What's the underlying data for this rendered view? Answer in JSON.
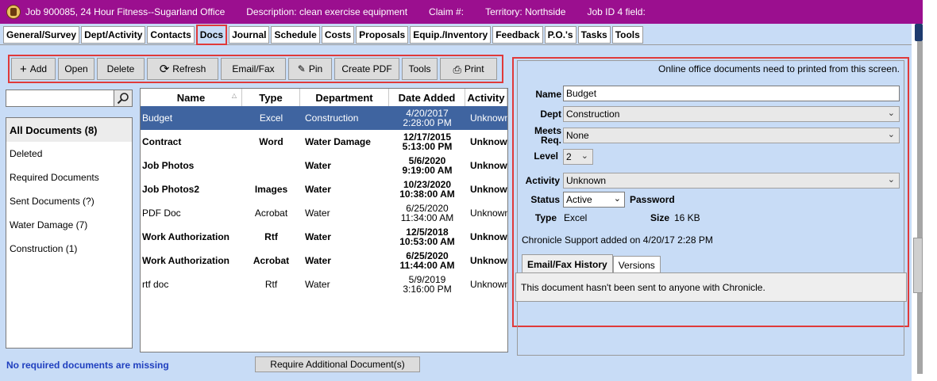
{
  "titlebar": {
    "job": "Job 900085, 24 Hour Fitness--Sugarland Office",
    "description": "Description: clean exercise equipment",
    "claim": "Claim #:",
    "territory": "Territory: Northside",
    "job_id_field": "Job ID 4 field:"
  },
  "tabs": [
    "General/Survey",
    "Dept/Activity",
    "Contacts",
    "Docs",
    "Journal",
    "Schedule",
    "Costs",
    "Proposals",
    "Equip./Inventory",
    "Feedback",
    "P.O.'s",
    "Tasks",
    "Tools"
  ],
  "active_tab": "Docs",
  "toolbar": {
    "add": "Add",
    "open": "Open",
    "delete": "Delete",
    "refresh": "Refresh",
    "email_fax": "Email/Fax",
    "pin": "Pin",
    "create_pdf": "Create PDF",
    "tools": "Tools",
    "print": "Print"
  },
  "search": {
    "value": ""
  },
  "folders": [
    "All Documents (8)",
    "Deleted",
    "Required Documents",
    "Sent Documents (?)",
    "Water Damage (7)",
    "Construction (1)"
  ],
  "table": {
    "headers": {
      "name": "Name",
      "type": "Type",
      "department": "Department",
      "date_added": "Date Added",
      "activity": "Activity"
    },
    "rows": [
      {
        "name": "Budget",
        "type": "Excel",
        "department": "Construction",
        "date": "4/20/2017",
        "time": "2:28:00 PM",
        "activity": "Unknown",
        "bold": false,
        "selected": true
      },
      {
        "name": "Contract",
        "type": "Word",
        "department": "Water Damage",
        "date": "12/17/2015",
        "time": "5:13:00 PM",
        "activity": "Unknown",
        "bold": true,
        "selected": false
      },
      {
        "name": "Job Photos",
        "type": "",
        "department": "Water",
        "date": "5/6/2020",
        "time": "9:19:00 AM",
        "activity": "Unknown",
        "bold": true,
        "selected": false
      },
      {
        "name": "Job Photos2",
        "type": "Images",
        "department": "Water",
        "date": "10/23/2020",
        "time": "10:38:00 AM",
        "activity": "Unknown",
        "bold": true,
        "selected": false
      },
      {
        "name": "PDF Doc",
        "type": "Acrobat",
        "department": "Water",
        "date": "6/25/2020",
        "time": "11:34:00 AM",
        "activity": "Unknown",
        "bold": false,
        "selected": false
      },
      {
        "name": "Work Authorization",
        "type": "Rtf",
        "department": "Water",
        "date": "12/5/2018",
        "time": "10:53:00 AM",
        "activity": "Unknown",
        "bold": true,
        "selected": false
      },
      {
        "name": "Work Authorization",
        "type": "Acrobat",
        "department": "Water",
        "date": "6/25/2020",
        "time": "11:44:00 AM",
        "activity": "Unknown",
        "bold": true,
        "selected": false
      },
      {
        "name": "rtf doc",
        "type": "Rtf",
        "department": "Water",
        "date": "5/9/2019",
        "time": "3:16:00 PM",
        "activity": "Unknown",
        "bold": false,
        "selected": false
      }
    ]
  },
  "details": {
    "notice": "Online office documents need to printed from this screen.",
    "name_label": "Name",
    "name_value": "Budget",
    "dept_label": "Dept",
    "dept_value": "Construction",
    "meets_label_1": "Meets",
    "meets_label_2": "Req.",
    "meets_value": "None",
    "level_label": "Level",
    "level_value": "2",
    "activity_label": "Activity",
    "activity_value": "Unknown",
    "status_label": "Status",
    "status_value": "Active",
    "password_label": "Password",
    "type_label": "Type",
    "type_value": "Excel",
    "size_label": "Size",
    "size_value": "16 KB",
    "added_by": "Chronicle Support added on 4/20/17 2:28 PM",
    "tab_history": "Email/Fax History",
    "tab_versions": "Versions",
    "history_text": "This document hasn't been sent to anyone with Chronicle."
  },
  "footer": {
    "message": "No required documents are missing",
    "require_button": "Require Additional Document(s)"
  }
}
